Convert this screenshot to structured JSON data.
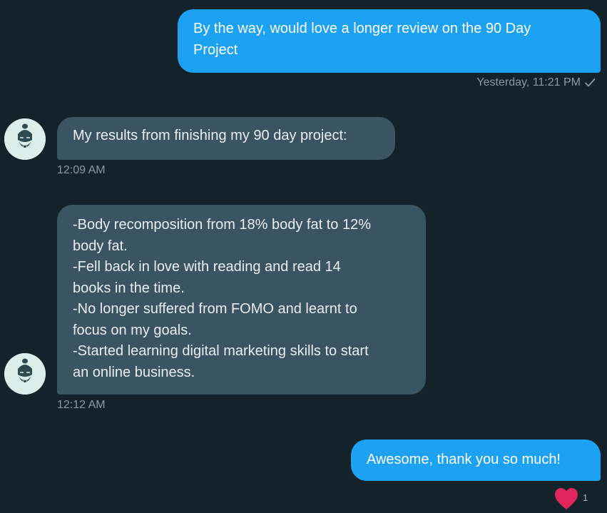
{
  "messages": [
    {
      "direction": "sent",
      "text": "By the way, would love a longer review on the 90 Day\nProject",
      "timestamp": "Yesterday, 11:21 PM",
      "status_icon": "check-icon"
    },
    {
      "direction": "received",
      "text": "My results from finishing my 90 day project:",
      "timestamp": "12:09 AM"
    },
    {
      "direction": "received",
      "text": "-Body recomposition from 18% body fat to 12%\nbody fat.\n-Fell back in love with reading and read 14\nbooks in the time.\n-No longer suffered from FOMO and learnt to\nfocus on my goals.\n-Started learning digital marketing skills to start\nan online business.",
      "timestamp": "12:12 AM"
    },
    {
      "direction": "sent",
      "text": "Awesome, thank you so much!",
      "reaction": {
        "icon": "heart-icon",
        "count": "1"
      }
    }
  ],
  "colors": {
    "background": "#14232a",
    "sent_bubble": "#1da1f2",
    "received_bubble": "#3a5561",
    "timestamp": "#8899a6",
    "heart": "#e0245e"
  }
}
